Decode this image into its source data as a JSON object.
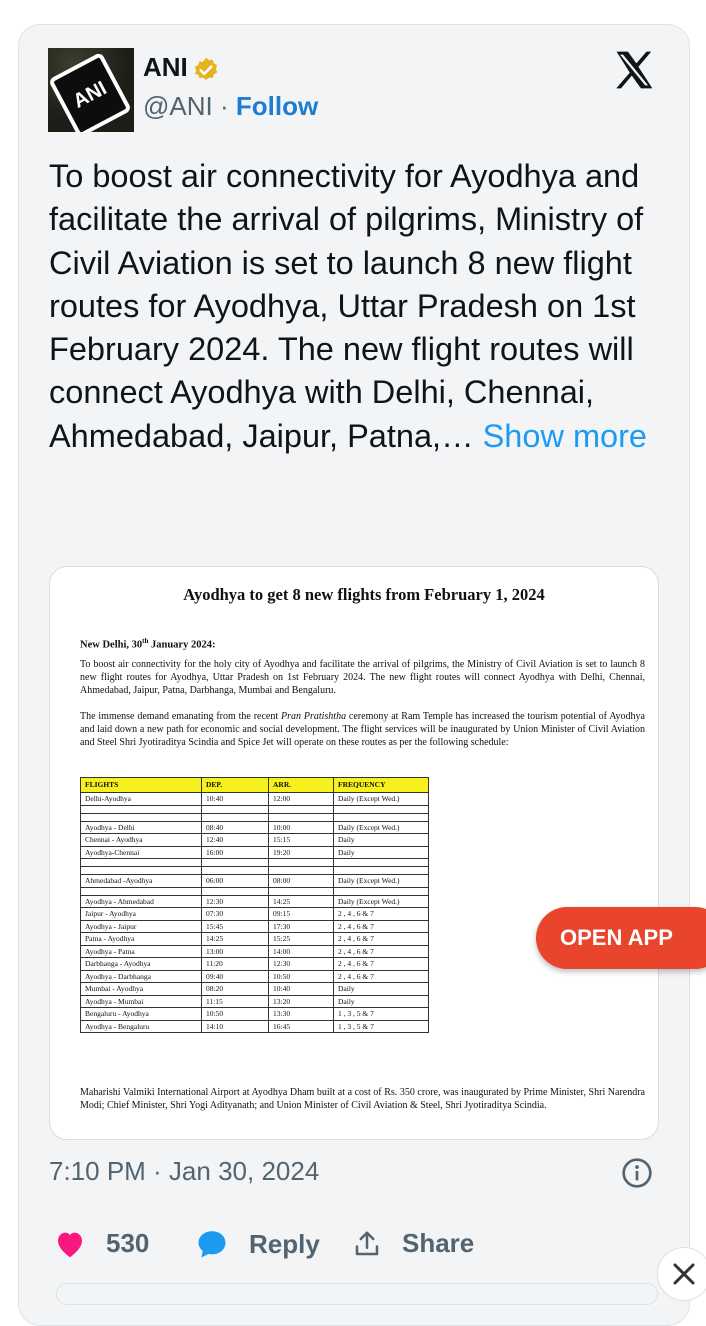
{
  "tweet": {
    "display_name": "ANI",
    "handle": "@ANI",
    "separator": "·",
    "follow_label": "Follow",
    "avatar_text": "ANI",
    "text": "To boost air connectivity for Ayodhya and facilitate the arrival of pilgrims, Ministry of Civil Aviation is set to launch 8 new flight routes for Ayodhya, Uttar Pradesh on 1st February 2024. The new flight routes will connect Ayodhya with Delhi, Chennai, Ahmedabad, Jaipur, Patna,…",
    "show_more_label": "Show more",
    "timestamp": "7:10 PM · Jan 30, 2024",
    "like_count": "530",
    "reply_label": "Reply",
    "share_label": "Share",
    "verified_color": "#e8b21e"
  },
  "document": {
    "title": "Ayodhya to get 8 new flights from February 1, 2024",
    "dateline_prefix": "New Delhi, 30",
    "dateline_sup": "th",
    "dateline_suffix": " January 2024:",
    "para1": "To boost air connectivity for the holy city of Ayodhya and facilitate the arrival of pilgrims, the Ministry of Civil Aviation is set to launch 8 new flight routes for Ayodhya, Uttar Pradesh on 1st February 2024. The new flight routes will connect Ayodhya with Delhi, Chennai, Ahmedabad, Jaipur, Patna, Darbhanga, Mumbai and Bengaluru.",
    "para2_a": "The immense demand emanating from the recent ",
    "para2_em": "Pran Pratishtha",
    "para2_b": " ceremony at Ram Temple has increased the tourism potential of Ayodhya and laid down a new path for economic and social development. The flight services will be inaugurated by Union Minister of Civil Aviation and Steel Shri Jyotiraditya Scindia and Spice Jet will operate on these routes as per the following schedule:",
    "table_headers": [
      "FLIGHTS",
      "DEP.",
      "ARR.",
      "FREQUENCY"
    ],
    "table_rows": [
      {
        "flight": "Delhi-Ayodhya",
        "dep": "10:40",
        "arr": "12:00",
        "freq": "Daily (Except Wed.)",
        "spaced": true
      },
      {
        "flight": "Ayodhya - Delhi",
        "dep": "08:40",
        "arr": "10:00",
        "freq": "Daily (Except Wed.)",
        "spaced": true
      },
      {
        "flight": "Chennai - Ayodhya",
        "dep": "12:40",
        "arr": "15:15",
        "freq": "Daily",
        "spaced": false
      },
      {
        "flight": "Ayodhya-Chennai",
        "dep": "16:00",
        "arr": "19:20",
        "freq": "Daily",
        "spaced": false
      },
      {
        "flight": "Ahmedabad -Ayodhya",
        "dep": "06:00",
        "arr": "08:00",
        "freq": "Daily (Except Wed.)",
        "spaced": true
      },
      {
        "flight": "Ayodhya - Ahmedabad",
        "dep": "12:30",
        "arr": "14:25",
        "freq": "Daily (Except Wed.)",
        "spaced": true
      },
      {
        "flight": "Jaipur - Ayodhya",
        "dep": "07:30",
        "arr": "09:15",
        "freq": "2 , 4 , 6 & 7",
        "spaced": false
      },
      {
        "flight": "Ayodhya - Jaipur",
        "dep": "15:45",
        "arr": "17:30",
        "freq": "2 , 4 , 6 & 7",
        "spaced": false
      },
      {
        "flight": "Patna - Ayodhya",
        "dep": "14:25",
        "arr": "15:25",
        "freq": "2 , 4 , 6 & 7",
        "spaced": false
      },
      {
        "flight": "Ayodhya - Patna",
        "dep": "13:00",
        "arr": "14:00",
        "freq": "2 , 4 , 6 & 7",
        "spaced": false
      },
      {
        "flight": "Darbhanga - Ayodhya",
        "dep": "11:20",
        "arr": "12:30",
        "freq": "2 , 4 , 6 & 7",
        "spaced": false
      },
      {
        "flight": "Ayodhya - Darbhanga",
        "dep": "09:40",
        "arr": "10:50",
        "freq": "2 , 4 , 6 & 7",
        "spaced": false
      },
      {
        "flight": "Mumbai - Ayodhya",
        "dep": "08:20",
        "arr": "10:40",
        "freq": "Daily",
        "spaced": false
      },
      {
        "flight": "Ayodhya - Mumbai",
        "dep": "11:15",
        "arr": "13:20",
        "freq": "Daily",
        "spaced": false
      },
      {
        "flight": "Bengaluru - Ayodhya",
        "dep": "10:50",
        "arr": "13:30",
        "freq": "1 , 3 , 5 & 7",
        "spaced": false
      },
      {
        "flight": "Ayodhya - Bengaluru",
        "dep": "14:10",
        "arr": "16:45",
        "freq": "1 , 3 , 5 & 7",
        "spaced": false
      }
    ],
    "footer": "Maharishi Valmiki International Airport at Ayodhya Dham built at a cost of Rs.  350 crore, was inaugurated by Prime Minister, Shri Narendra Modi; Chief Minister, Shri Yogi Adityanath; and Union Minister of Civil Aviation & Steel, Shri Jyotiraditya Scindia."
  },
  "overlay": {
    "open_app_label": "OPEN APP",
    "open_app_color": "#e8452c"
  }
}
